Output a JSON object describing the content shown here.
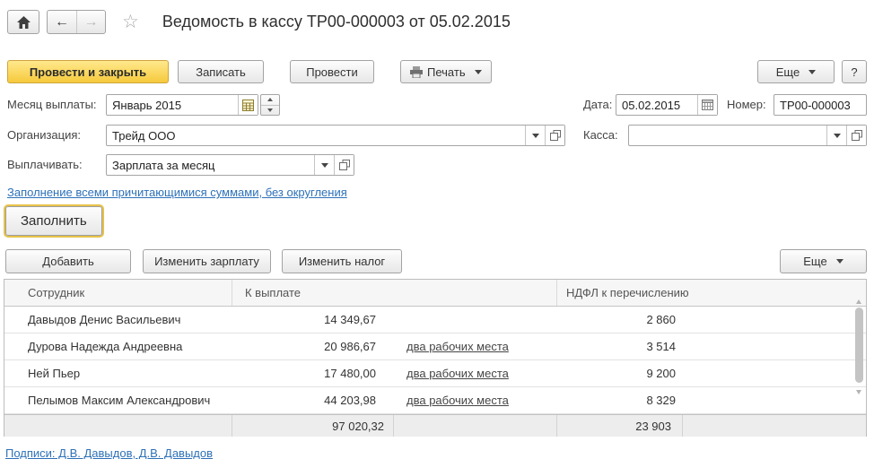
{
  "window": {
    "title": "Ведомость в кассу ТР00-000003 от 05.02.2015"
  },
  "toolbar": {
    "post_and_close": "Провести и закрыть",
    "save": "Записать",
    "post": "Провести",
    "print": "Печать",
    "more": "Еще",
    "help": "?"
  },
  "form": {
    "month_label": "Месяц выплаты:",
    "month_value": "Январь 2015",
    "date_label": "Дата:",
    "date_value": "05.02.2015",
    "number_label": "Номер:",
    "number_value": "ТР00-000003",
    "org_label": "Организация:",
    "org_value": "Трейд ООО",
    "cashbox_label": "Касса:",
    "cashbox_value": "",
    "pay_label": "Выплачивать:",
    "pay_value": "Зарплата за месяц",
    "fill_link": "Заполнение всеми причитающимися суммами, без округления",
    "fill_button": "Заполнить"
  },
  "table_toolbar": {
    "add": "Добавить",
    "edit_salary": "Изменить зарплату",
    "edit_tax": "Изменить налог",
    "more": "Еще"
  },
  "table": {
    "columns": [
      "Сотрудник",
      "К выплате",
      "НДФЛ к перечислению"
    ],
    "rows": [
      {
        "name": "Давыдов Денис Васильевич",
        "amount": "14 349,67",
        "link": "",
        "tax": "2 860"
      },
      {
        "name": "Дурова Надежда Андреевна",
        "amount": "20 986,67",
        "link": "два рабочих места",
        "tax": "3 514"
      },
      {
        "name": "Ней Пьер",
        "amount": "17 480,00",
        "link": "два рабочих места",
        "tax": "9 200"
      },
      {
        "name": "Пелымов Максим Александрович",
        "amount": "44 203,98",
        "link": "два рабочих места",
        "tax": "8 329"
      }
    ],
    "totals": {
      "amount": "97 020,32",
      "tax": "23 903"
    }
  },
  "footer": {
    "signatures": "Подписи: Д.В. Давыдов, Д.В. Давыдов"
  },
  "colors": {
    "accent_yellow": "#f6c93c",
    "link_blue": "#2e71b8"
  }
}
